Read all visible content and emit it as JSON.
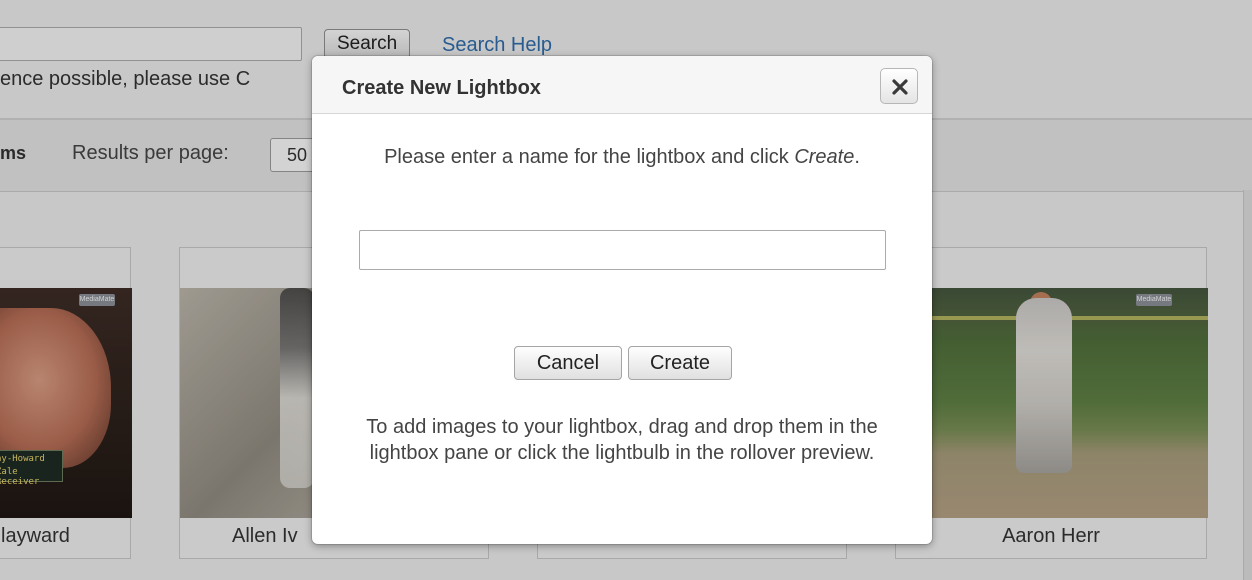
{
  "background": {
    "search": {
      "button_label": "Search",
      "help_link": "Search Help",
      "notice": "ence possible, please use C"
    },
    "toolbar": {
      "view_items_label": "ms",
      "results_per_page_label": "Results per page:",
      "results_per_page_value": "50"
    },
    "results": [
      {
        "caption": "layward",
        "lower_third_line1": "ay-Howard",
        "lower_third_line2": "Zale Receiver",
        "logo_text": "MediaMate"
      },
      {
        "caption": "Allen Iv"
      },
      {
        "caption": ""
      },
      {
        "caption": "Aaron Herr",
        "logo_text": "MediaMate"
      }
    ]
  },
  "dialog": {
    "title": "Create New Lightbox",
    "close_icon": "close-icon",
    "instruction_before": "Please enter a name for the lightbox and click ",
    "instruction_emphasis": "Create",
    "instruction_after": ".",
    "name_input_value": "",
    "name_input_placeholder": "",
    "cancel_label": "Cancel",
    "create_label": "Create",
    "help_text": "To add images to your lightbox, drag and drop them in the lightbox pane or click the lightbulb in the rollover preview."
  },
  "colors": {
    "link": "#2f6ba8",
    "overlay": "rgba(0,0,0,0.14)",
    "dialog_bg": "#ffffff"
  }
}
